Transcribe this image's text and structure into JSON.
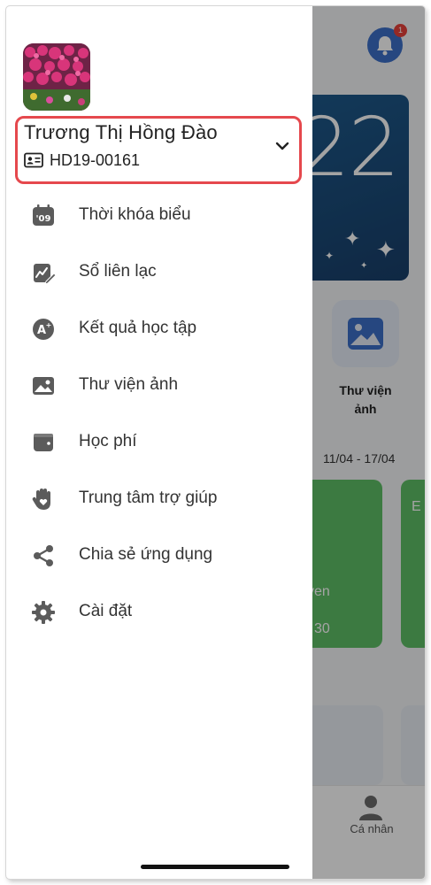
{
  "background": {
    "notification_count": "1",
    "banner_number": "22",
    "gallery_label_line1": "Thư viện",
    "gallery_label_line2": "ảnh",
    "week_range": "11/04 - 17/04",
    "green_card_text1": "yen",
    "green_card_text2": "30",
    "green_card_letter": "E",
    "tab_profile_label": "Cá nhân"
  },
  "drawer": {
    "profile": {
      "name": "Trương Thị Hồng Đào",
      "student_id": "HD19-00161"
    },
    "menu": [
      {
        "label": "Thời khóa biểu",
        "icon": "calendar-09-icon"
      },
      {
        "label": "Sổ liên lạc",
        "icon": "notebook-chart-icon"
      },
      {
        "label": "Kết quả học tập",
        "icon": "result-badge-icon"
      },
      {
        "label": "Thư viện ảnh",
        "icon": "image-icon"
      },
      {
        "label": "Học phí",
        "icon": "wallet-icon"
      },
      {
        "label": "Trung tâm trợ giúp",
        "icon": "help-hand-heart-icon"
      },
      {
        "label": "Chia sẻ ứng dụng",
        "icon": "share-icon"
      },
      {
        "label": "Cài đặt",
        "icon": "gear-icon"
      }
    ]
  },
  "colors": {
    "highlight_border": "#e5484d",
    "icon_gray": "#5b5b5b",
    "primary_blue": "#3c6fc8",
    "green_card": "#5fbf66"
  }
}
